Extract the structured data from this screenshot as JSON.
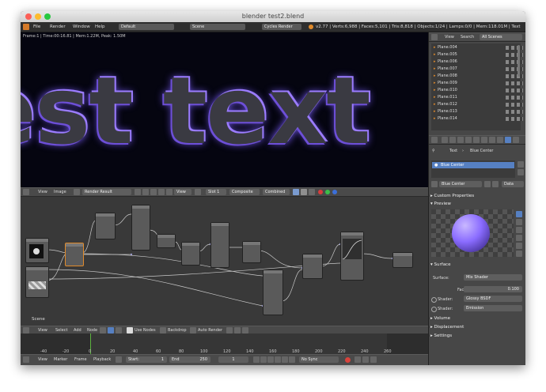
{
  "window": {
    "title": "blender test2.blend"
  },
  "infobar": {
    "menus": [
      "File",
      "Render",
      "Window",
      "Help"
    ],
    "layout": "Default",
    "scene": "Scene",
    "engine": "Cycles Render",
    "stats": "v2.77 | Verts:6,988 | Faces:5,101 | Tris:8,818 | Objects:1/24 | Lamps:0/0 | Mem:118.01M | Text"
  },
  "render": {
    "stats": "Frame:1 | Time:00:16.81 | Mem:1.22M, Peak: 1.50M",
    "text": "est text"
  },
  "image_header": {
    "view": "View",
    "image": "Image",
    "image_name": "Render Result",
    "view2": "View",
    "slot": "Slot 1",
    "layer": "Composite",
    "pass": "Combined"
  },
  "node_editor": {
    "scene_label": "Scene",
    "header": {
      "view": "View",
      "select": "Select",
      "add": "Add",
      "node": "Node",
      "use_nodes": "Use Nodes",
      "backdrop": "Backdrop",
      "auto_render": "Auto Render"
    }
  },
  "timeline": {
    "ticks": [
      "-40",
      "-20",
      "0",
      "20",
      "40",
      "60",
      "80",
      "100",
      "120",
      "140",
      "160",
      "180",
      "200",
      "220",
      "240",
      "260"
    ],
    "header": {
      "view": "View",
      "marker": "Marker",
      "frame": "Frame",
      "playback": "Playback",
      "start": "Start:",
      "start_val": "1",
      "end": "End",
      "end_val": "250",
      "current": "1",
      "sync": "No Sync"
    }
  },
  "outliner": {
    "view": "View",
    "search": "Search",
    "filter": "All Scenes",
    "items": [
      "Plane.004",
      "Plane.005",
      "Plane.006",
      "Plane.007",
      "Plane.008",
      "Plane.009",
      "Plane.010",
      "Plane.011",
      "Plane.012",
      "Plane.013",
      "Plane.014"
    ]
  },
  "properties": {
    "breadcrumb_obj": "Text",
    "breadcrumb_mat": "Blue Center",
    "material_slot": "Blue Center",
    "material_name": "Blue Center",
    "data": "Data",
    "custom_properties": "Custom Properties",
    "preview": "Preview",
    "surface": "Surface",
    "surface_label": "Surface:",
    "surface_val": "Mix Shader",
    "fac_label": "Fac:",
    "fac_val": "0.100",
    "shader_label1": "Shader:",
    "shader_val1": "Glossy BSDF",
    "shader_label2": "Shader:",
    "shader_val2": "Emission",
    "volume": "Volume",
    "displacement": "Displacement",
    "settings": "Settings"
  },
  "colors": {
    "accent": "#5680c2",
    "glow": "#8a6cff",
    "play_red": "#d9433c"
  }
}
